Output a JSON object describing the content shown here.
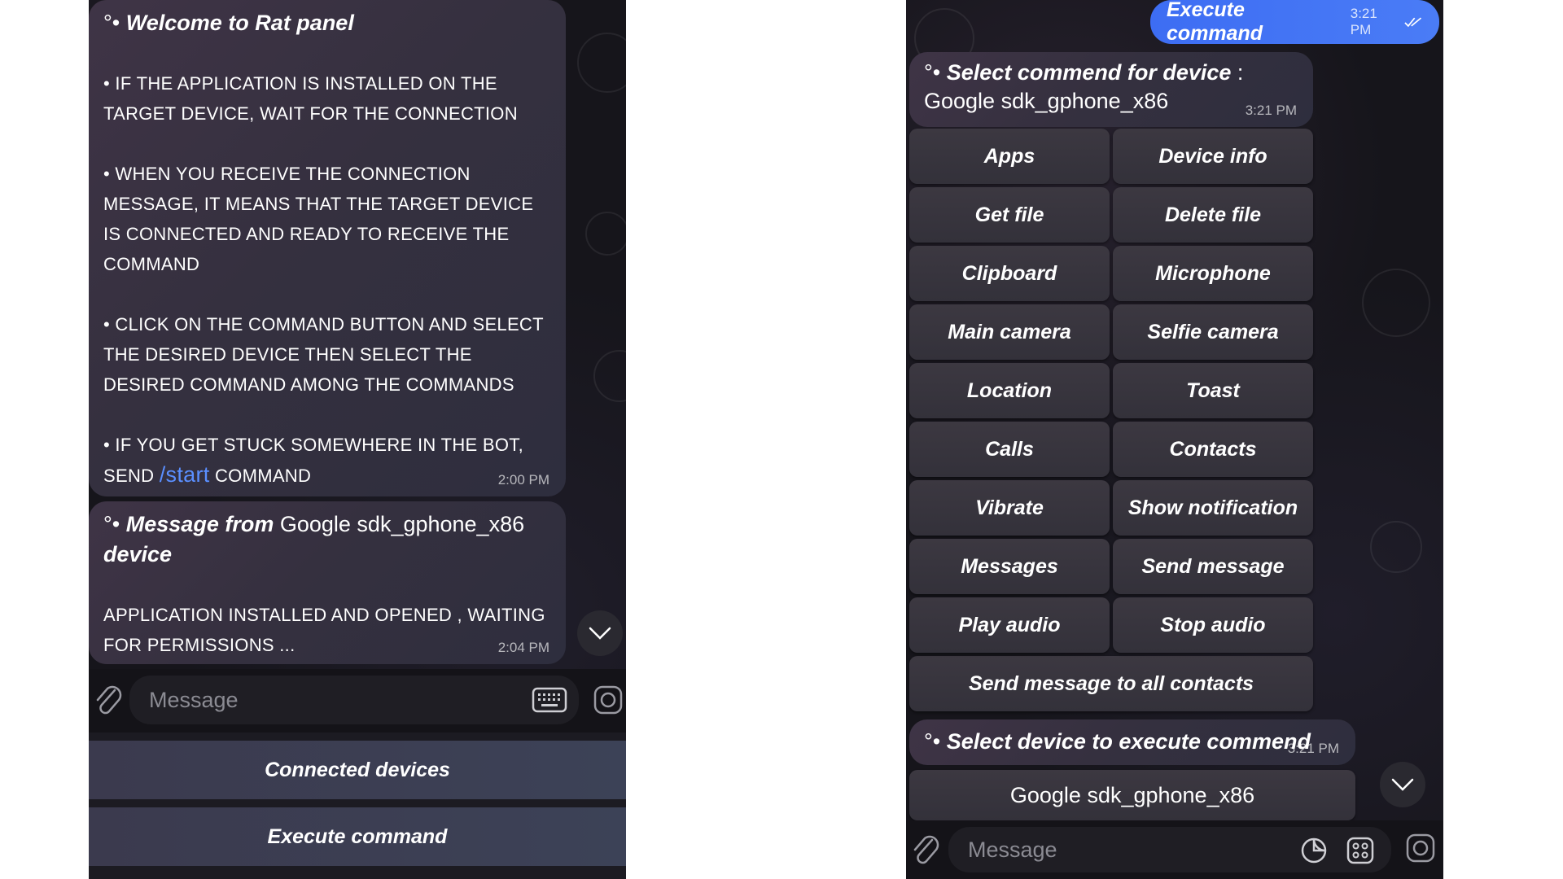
{
  "left": {
    "welcome": {
      "title": "Welcome to Rat panel",
      "prefix": "°•",
      "p1": "• IF THE APPLICATION IS INSTALLED ON THE TARGET DEVICE, WAIT FOR THE CONNECTION",
      "p2": "• WHEN YOU RECEIVE THE CONNECTION MESSAGE, IT MEANS THAT THE TARGET DEVICE IS CONNECTED AND READY TO RECEIVE THE COMMAND",
      "p3": "• CLICK ON THE COMMAND BUTTON AND SELECT THE DESIRED DEVICE THEN SELECT THE DESIRED COMMAND AMONG THE COMMANDS",
      "p4_before": "• IF YOU GET STUCK SOMEWHERE IN THE BOT, SEND",
      "p4_link": "/start",
      "p4_after": "COMMAND",
      "time": "2:00 PM"
    },
    "device_msg": {
      "prefix": "°•",
      "title_italic": "Message from",
      "device_name": "Google sdk_gphone_x86",
      "title_end": "device",
      "body": "APPLICATION INSTALLED AND OPENED , WAITING FOR PERMISSIONS ...",
      "time": "2:04 PM"
    },
    "input_placeholder": "Message",
    "reply_buttons": [
      "Connected devices",
      "Execute command"
    ]
  },
  "right": {
    "outgoing": {
      "text": "Execute command",
      "time": "3:21 PM"
    },
    "select_msg": {
      "prefix": "°•",
      "italic": "Select commend for device",
      "sep": ":",
      "device": "Google sdk_gphone_x86",
      "time": "3:21 PM"
    },
    "commands": [
      [
        "Apps",
        "Device info"
      ],
      [
        "Get file",
        "Delete file"
      ],
      [
        "Clipboard",
        "Microphone"
      ],
      [
        "Main camera",
        "Selfie camera"
      ],
      [
        "Location",
        "Toast"
      ],
      [
        "Calls",
        "Contacts"
      ],
      [
        "Vibrate",
        "Show notification"
      ],
      [
        "Messages",
        "Send message"
      ],
      [
        "Play audio",
        "Stop audio"
      ]
    ],
    "command_wide": "Send message to all contacts",
    "select_device": {
      "prefix": "°•",
      "text": "Select device to execute commend",
      "time": "3:21 PM"
    },
    "device_button": "Google sdk_gphone_x86",
    "input_placeholder": "Message"
  },
  "colors": {
    "accent_blue": "#4a7cf6",
    "link_blue": "#5a8fff",
    "chat_bg": "#16151b"
  }
}
